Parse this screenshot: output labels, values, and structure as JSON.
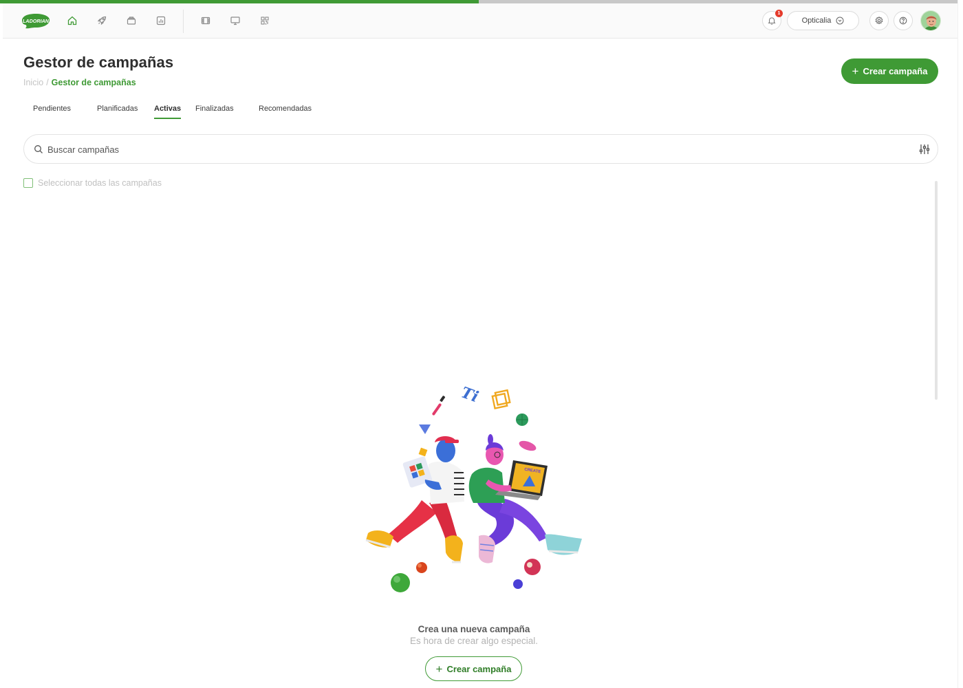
{
  "colors": {
    "accent": "#3f9a35",
    "accent_dark": "#2f7d27",
    "badge": "#e53b2c",
    "progress_track": "#c8c8c8"
  },
  "progress": {
    "fraction": 0.5
  },
  "topbar": {
    "logo_text": "LADORIAN",
    "nav_icons": [
      "home-icon",
      "rocket-icon",
      "layers-icon",
      "analytics-icon",
      "film-icon",
      "monitor-icon",
      "qr-code-icon"
    ],
    "notifications_count": "1",
    "account_name": "Opticalia",
    "right_icons": [
      "bell-icon",
      "settings-icon",
      "help-icon",
      "avatar"
    ]
  },
  "header": {
    "title": "Gestor de campañas",
    "breadcrumb_home": "Inicio",
    "breadcrumb_separator": "/",
    "breadcrumb_current": "Gestor de campañas",
    "create_button": "Crear campaña",
    "plus_symbol": "+"
  },
  "tabs": [
    {
      "label": "Pendientes",
      "active": false
    },
    {
      "label": "Planificadas",
      "active": false
    },
    {
      "label": "Activas",
      "active": true
    },
    {
      "label": "Finalizadas",
      "active": false
    },
    {
      "label": "Recomendadas",
      "active": false
    }
  ],
  "search": {
    "placeholder": "Buscar campañas",
    "value": ""
  },
  "select_all": {
    "label": "Seleccionar todas las campañas",
    "checked": false
  },
  "empty_state": {
    "title": "Crea una nueva campaña",
    "subtitle": "Es hora de crear algo especial.",
    "button": "Crear campaña",
    "plus_symbol": "+",
    "illustration_text": "CREATE"
  }
}
